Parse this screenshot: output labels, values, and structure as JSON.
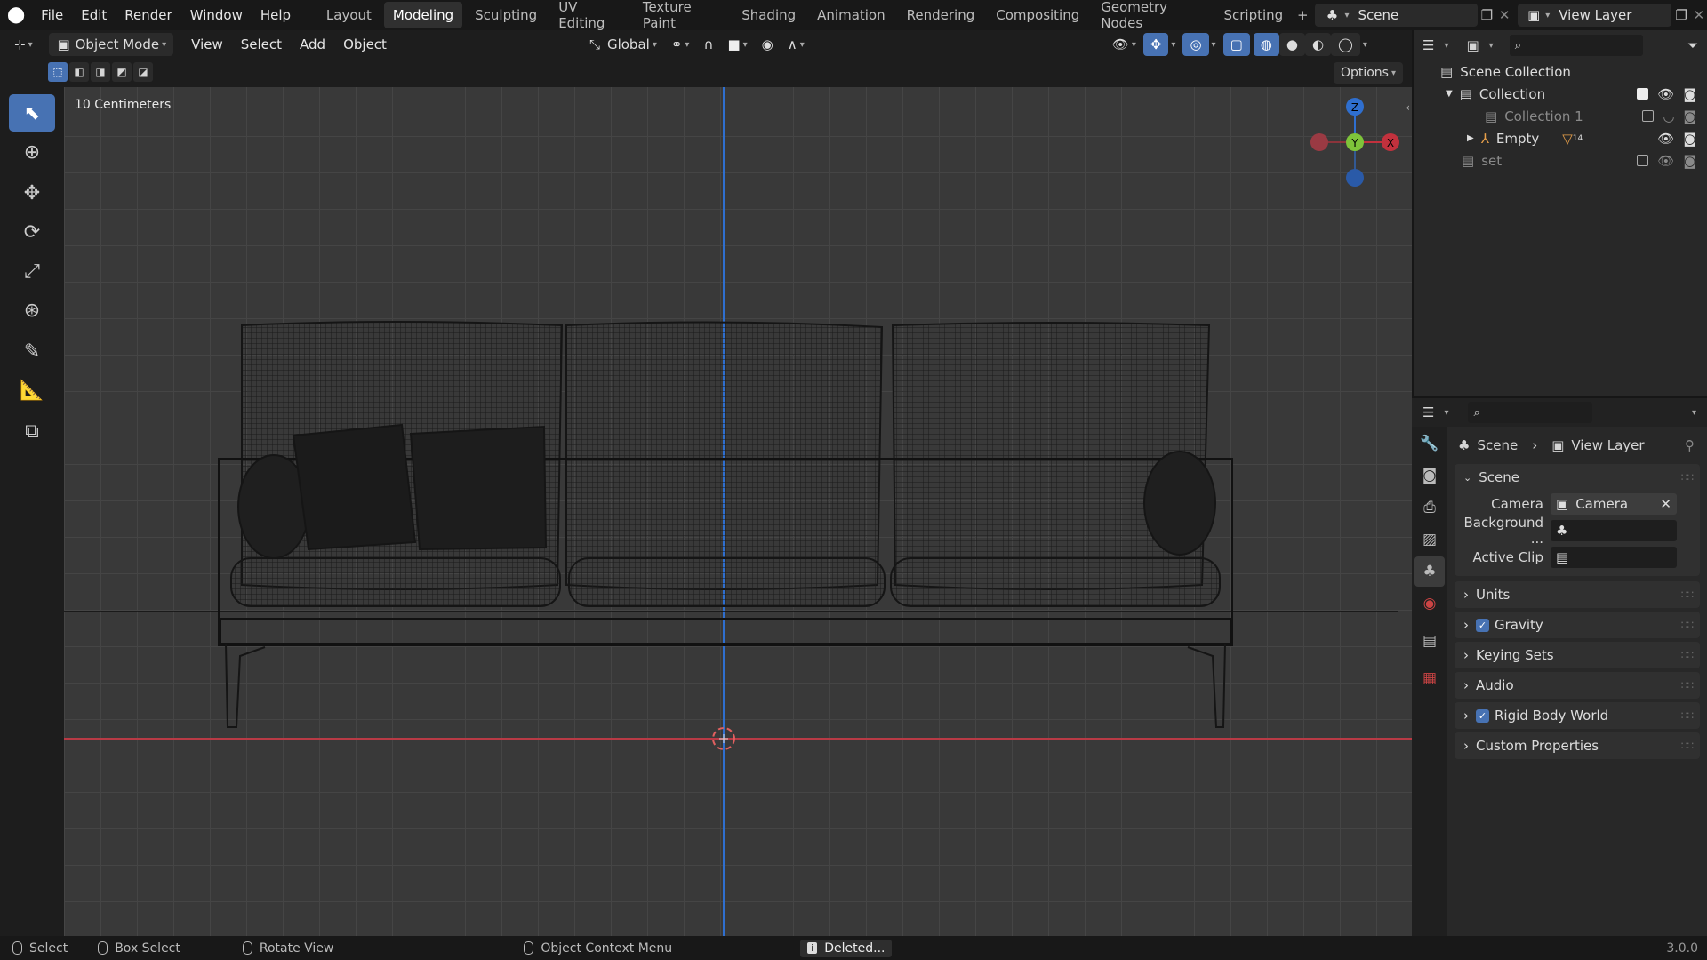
{
  "topbar": {
    "menus": [
      "File",
      "Edit",
      "Render",
      "Window",
      "Help"
    ],
    "workspaces": [
      "Layout",
      "Modeling",
      "Sculpting",
      "UV Editing",
      "Texture Paint",
      "Shading",
      "Animation",
      "Rendering",
      "Compositing",
      "Geometry Nodes",
      "Scripting"
    ],
    "active_workspace": "Modeling",
    "scene": "Scene",
    "view_layer": "View Layer"
  },
  "viewport_header": {
    "mode": "Object Mode",
    "menus": [
      "View",
      "Select",
      "Add",
      "Object"
    ],
    "transform_orientation": "Global",
    "options_label": "Options"
  },
  "viewport": {
    "scale_label": "10 Centimeters",
    "gizmo": {
      "x": "X",
      "y": "Y",
      "z": "Z"
    }
  },
  "outliner": {
    "root": "Scene Collection",
    "items": [
      {
        "label": "Collection",
        "dim": false
      },
      {
        "label": "Collection 1",
        "dim": true
      },
      {
        "label": "Empty",
        "dim": false,
        "badge": "14"
      },
      {
        "label": "set",
        "dim": true
      }
    ]
  },
  "properties": {
    "breadcrumb": [
      "Scene",
      "View Layer"
    ],
    "scene_panel": {
      "title": "Scene",
      "camera_label": "Camera",
      "camera_value": "Camera",
      "background_label": "Background ...",
      "active_clip_label": "Active Clip"
    },
    "panels": [
      {
        "label": "Units",
        "checkbox": false
      },
      {
        "label": "Gravity",
        "checkbox": true
      },
      {
        "label": "Keying Sets",
        "checkbox": false
      },
      {
        "label": "Audio",
        "checkbox": false
      },
      {
        "label": "Rigid Body World",
        "checkbox": true
      },
      {
        "label": "Custom Properties",
        "checkbox": false
      }
    ]
  },
  "statusbar": {
    "select": "Select",
    "box_select": "Box Select",
    "rotate_view": "Rotate View",
    "context_menu": "Object Context Menu",
    "report": "Deleted...",
    "version": "3.0.0"
  },
  "colors": {
    "accent": "#4772b3",
    "axis_x": "#c2313d",
    "axis_y": "#7ec43a",
    "axis_z": "#2f6fcf"
  }
}
